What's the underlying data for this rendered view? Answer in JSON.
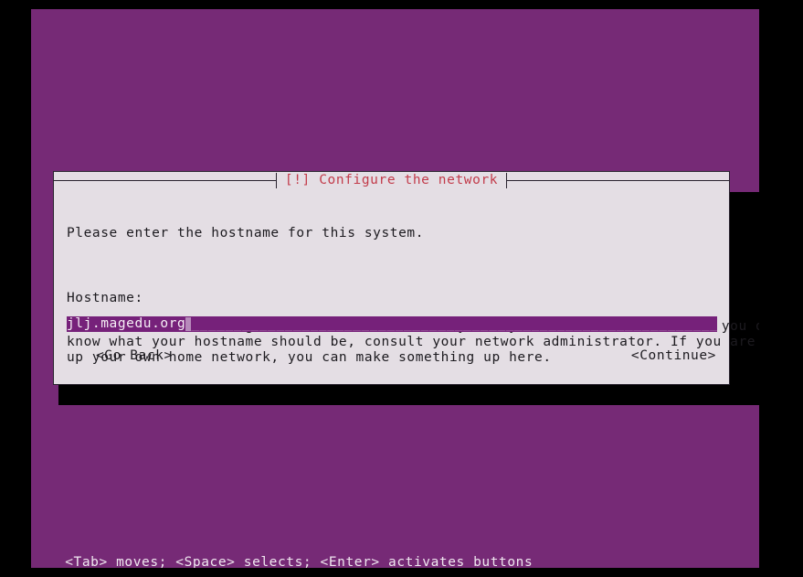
{
  "terminal": {
    "background_color": "#762a76",
    "outer_background_color": "#000000"
  },
  "dialog": {
    "title": "[!] Configure the network",
    "title_color": "#c23b4a",
    "background_color": "#e4dee4",
    "border_color": "#2b2430",
    "paragraphs": [
      "Please enter the hostname for this system.",
      "The hostname is a single word that identifies your system to the network. If you don't\nknow what your hostname should be, consult your network administrator. If you are setting\nup your own home network, you can make something up here."
    ],
    "hostname_label": "Hostname:",
    "hostname_input": {
      "value": "jlj.magedu.org",
      "placeholder": "",
      "fill_character": "_",
      "fill": "____________________________________________________________________________________",
      "field_background_color": "#76217a",
      "text_color": "#f6eff6",
      "cursor_color": "#b78abb"
    },
    "buttons": {
      "go_back": "<Go Back>",
      "continue": "<Continue>"
    }
  },
  "status_bar": {
    "text": "<Tab> moves; <Space> selects; <Enter> activates buttons",
    "text_color": "#f0e7f0"
  }
}
